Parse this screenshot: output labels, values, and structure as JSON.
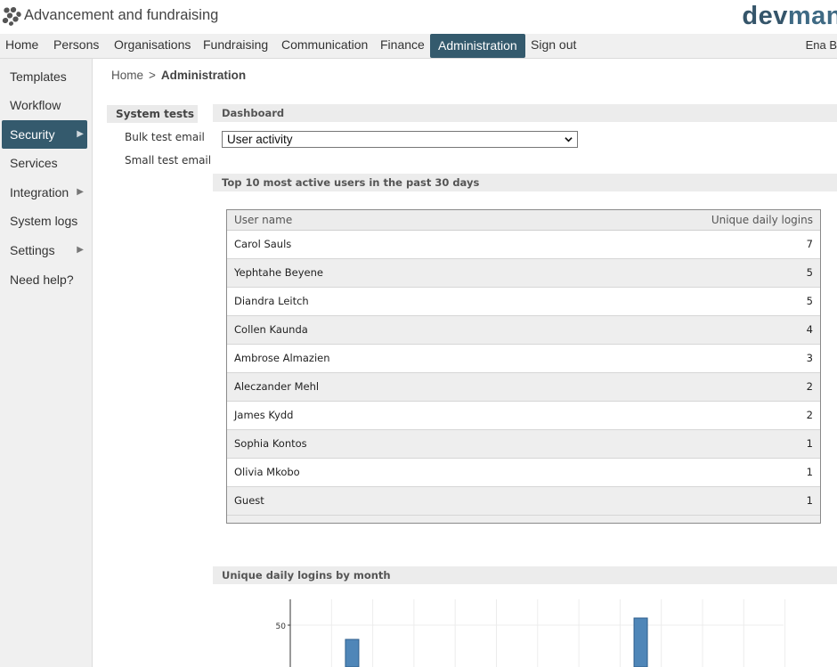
{
  "app": {
    "title": "Advancement and fundraising",
    "brand_prefix": "dev",
    "brand_suffix": "man",
    "brand_color_dark": "#35556a",
    "brand_color_accent": "#3f6a84",
    "logo_icon": "honeycomb-icon"
  },
  "nav": {
    "items": [
      "Home",
      "Persons",
      "Organisations",
      "Fundraising",
      "Communication",
      "Finance",
      "Administration",
      "Sign out"
    ],
    "active": "Administration",
    "user": "Ena B"
  },
  "sidebar": {
    "items": [
      {
        "label": "Templates",
        "arrow": ""
      },
      {
        "label": "Workflow",
        "arrow": ""
      },
      {
        "label": "Security",
        "arrow": "▶"
      },
      {
        "label": "Services",
        "arrow": ""
      },
      {
        "label": "Integration",
        "arrow": "▶"
      },
      {
        "label": "System logs",
        "arrow": ""
      },
      {
        "label": "Settings",
        "arrow": "▶"
      },
      {
        "label": "Need help?",
        "arrow": ""
      }
    ],
    "active": "Security"
  },
  "breadcrumb": {
    "home": "Home",
    "separator": ">",
    "current": "Administration"
  },
  "subnav": {
    "heading": "System tests",
    "links": [
      "Bulk test email",
      "Small test email"
    ]
  },
  "dashboard": {
    "heading": "Dashboard",
    "select_value": "User activity",
    "top_users_heading": "Top 10 most active users in the past 30 days",
    "table": {
      "columns": [
        "User name",
        "Unique daily logins"
      ],
      "rows": [
        [
          "Carol Sauls",
          "7"
        ],
        [
          "Yephtahe Beyene",
          "5"
        ],
        [
          "Diandra Leitch",
          "5"
        ],
        [
          "Collen Kaunda",
          "4"
        ],
        [
          "Ambrose Almazien",
          "3"
        ],
        [
          "Aleczander Mehl",
          "2"
        ],
        [
          "James Kydd",
          "2"
        ],
        [
          "Sophia Kontos",
          "1"
        ],
        [
          "Olivia Mkobo",
          "1"
        ],
        [
          "Guest",
          "1"
        ]
      ]
    },
    "chart_heading": "Unique daily logins by month"
  },
  "colors": {
    "nav_active": "#345a6d",
    "bar": "#4f86b8"
  },
  "chart_data": {
    "type": "bar",
    "title": "",
    "visible_ticks": [
      "50"
    ],
    "bars": [
      {
        "slot": 2,
        "value": 40
      },
      {
        "slot": 9,
        "value": 55
      }
    ]
  }
}
